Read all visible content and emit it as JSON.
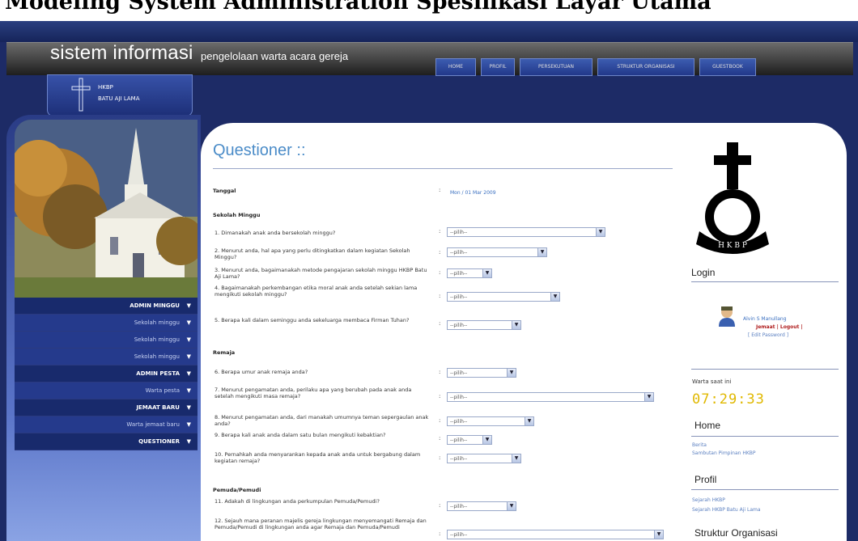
{
  "caption": {
    "text": "Modeling System Administration Spesifikasi Layar Utama"
  },
  "header": {
    "brand": "sistem informasi",
    "subtitle": "pengelolaan warta acara gereja",
    "nav": [
      "HOME",
      "PROFIL",
      "PERSEKUTUAN",
      "STRUKTUR ORGANISASI",
      "GUESTBOOK"
    ]
  },
  "logo": {
    "line1": "HKBP",
    "line2": "BATU AJI LAMA"
  },
  "sidebar": {
    "menu": [
      {
        "label": "ADMIN MINGGU",
        "type": "head"
      },
      {
        "label": "Sekolah minggu",
        "type": "sub"
      },
      {
        "label": "Sekolah minggu",
        "type": "sub"
      },
      {
        "label": "Sekolah minggu",
        "type": "sub"
      },
      {
        "label": "ADMIN PESTA",
        "type": "head"
      },
      {
        "label": "Warta pesta",
        "type": "sub"
      },
      {
        "label": "JEMAAT BARU",
        "type": "head"
      },
      {
        "label": "Warta jemaat baru",
        "type": "sub"
      },
      {
        "label": "QUESTIONER",
        "type": "head"
      }
    ]
  },
  "questioner": {
    "title": "Questioner ::",
    "tanggal_label": "Tanggal",
    "tanggal_value": "Mon / 01 Mar 2009",
    "section1": "Sekolah Minggu",
    "section2": "Remaja",
    "section3": "Pemuda/Pemudi",
    "select_placeholder": "--pilih--",
    "questions": [
      "Dimanakah anak anda bersekolah minggu?",
      "Menurut anda, hal apa yang perlu ditingkatkan dalam kegiatan Sekolah Minggu?",
      "Menurut anda, bagaimanakah metode pengajaran sekolah minggu HKBP Batu Aji Lama?",
      "Bagaimanakah perkembangan etika moral anak anda setelah sekian lama mengikuti sekolah minggu?",
      "Berapa kali dalam seminggu anda sekeluarga membaca Firman Tuhan?",
      "Berapa umur anak remaja anda?",
      "Menurut pengamatan anda, perilaku apa yang berubah pada anak anda setelah mengikuti masa remaja?",
      "Menurut pengamatan anda, dari manakah umumnya teman sepergaulan anak anda?",
      "Berapa kali anak anda dalam satu bulan mengikuti kebaktian?",
      "Pernahkah anda menyarankan kepada anak anda untuk bergabung dalam kegiatan remaja?",
      "Adakah di lingkungan anda perkumpulan Pemuda/Pemudi?",
      "Sejauh mana peranan majelis gereja lingkungan menyemangati Remaja dan Pemuda/Pemudi di lingkungan anda agar Remaja dan Pemuda/Pemudi"
    ]
  },
  "right": {
    "login_title": "Login",
    "user_name": "Alvin S Manullang",
    "user_links": "Jemaat | Logout |",
    "user_link2": "[ Edit Password ]",
    "clock_label": "Warta saat ini",
    "clock_value": "07:29:33",
    "home_title": "Home",
    "home_links": [
      "Berita",
      "Sambutan Pimpinan HKBP"
    ],
    "profil_title": "Profil",
    "profil_links": [
      "Sejarah HKBP",
      "Sejarah HKBP Batu Aji Lama"
    ],
    "struktur_title": "Struktur Organisasi"
  }
}
